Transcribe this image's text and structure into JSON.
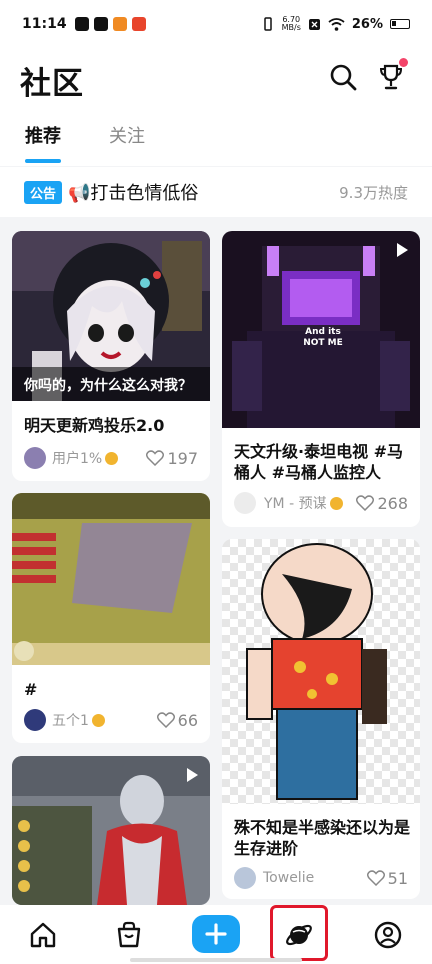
{
  "status_bar": {
    "time": "11:14",
    "net_speed_value": "6.70",
    "net_speed_unit": "MB/s",
    "battery": "26%"
  },
  "header": {
    "title": "社区",
    "icons": [
      "search-icon",
      "trophy-icon"
    ],
    "has_notification_dot": true
  },
  "tabs": [
    {
      "label": "推荐",
      "active": true
    },
    {
      "label": "关注",
      "active": false
    }
  ],
  "notice": {
    "badge": "公告",
    "text": "📢打击色情低俗",
    "heat": "9.3万热度"
  },
  "posts": [
    {
      "title": "明天更新鸡投乐2.0",
      "image_caption": "你吗的，为什么这么对我？",
      "author": "用户1%",
      "verified": true,
      "likes": "197",
      "is_video": false
    },
    {
      "title": "天文升级·泰坦电视 #马桶人 #马桶人监控人",
      "image_caption": "And its NOT ME",
      "author": "YM - 预谋",
      "verified": true,
      "likes": "268",
      "is_video": true
    },
    {
      "title": "#",
      "author": "五个1",
      "verified": true,
      "likes": "66",
      "is_video": false
    },
    {
      "title": "殊不知是半感染还以为是生存进阶",
      "author": "Towelie",
      "verified": false,
      "likes": "51",
      "is_video": false
    },
    {
      "title": "",
      "author": "",
      "verified": false,
      "likes": "",
      "is_video": true
    }
  ],
  "bottom_nav": [
    {
      "name": "home",
      "icon": "home-icon"
    },
    {
      "name": "shop",
      "icon": "shopping-bag-icon"
    },
    {
      "name": "create",
      "icon": "plus-icon"
    },
    {
      "name": "community",
      "icon": "planet-icon",
      "active": true
    },
    {
      "name": "profile",
      "icon": "user-icon"
    }
  ],
  "colors": {
    "accent": "#1aa3f4",
    "highlight_border": "#e0182b",
    "badge_gold": "#f1b42f"
  }
}
